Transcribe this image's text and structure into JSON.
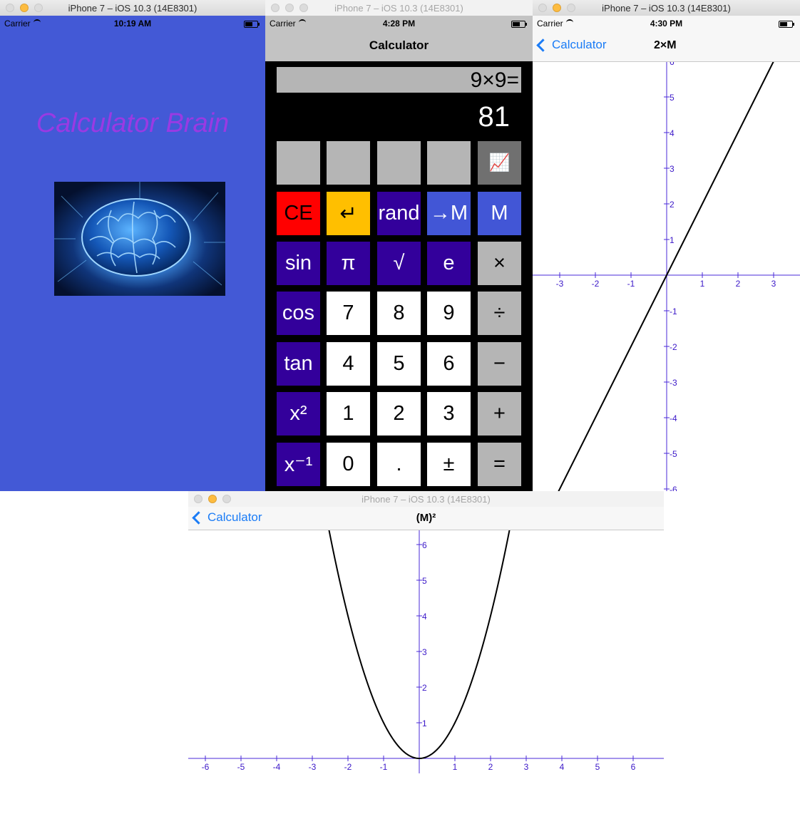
{
  "windows": {
    "brand": {
      "title": "iPhone 7 – iOS 10.3 (14E8301)",
      "carrier": "Carrier",
      "time": "10:19 AM",
      "app_title": "Calculator Brain"
    },
    "calculator": {
      "title": "iPhone 7 – iOS 10.3 (14E8301)",
      "carrier": "Carrier",
      "time": "4:28 PM",
      "nav_title": "Calculator",
      "description": "9×9=",
      "display": "81",
      "keys": [
        [
          "",
          "",
          "",
          "",
          "📈"
        ],
        [
          "CE",
          "↵",
          "rand",
          "→M",
          "M"
        ],
        [
          "sin",
          "π",
          "√",
          "e",
          "×"
        ],
        [
          "cos",
          "7",
          "8",
          "9",
          "÷"
        ],
        [
          "tan",
          "4",
          "5",
          "6",
          "−"
        ],
        [
          "x²",
          "1",
          "2",
          "3",
          "+"
        ],
        [
          "x⁻¹",
          "0",
          ".",
          "±",
          "="
        ]
      ],
      "key_styles": [
        [
          "gray",
          "gray",
          "gray",
          "gray",
          "dgray"
        ],
        [
          "red",
          "yel",
          "purple",
          "blue",
          "blue"
        ],
        [
          "purple",
          "purple",
          "purple",
          "purple",
          "gray"
        ],
        [
          "purple",
          "white",
          "white",
          "white",
          "gray"
        ],
        [
          "purple",
          "white",
          "white",
          "white",
          "gray"
        ],
        [
          "purple",
          "white",
          "white",
          "white",
          "gray"
        ],
        [
          "purple",
          "white",
          "white",
          "white",
          "gray"
        ]
      ]
    },
    "graph_linear": {
      "title": "iPhone 7 – iOS 10.3 (14E8301)",
      "carrier": "Carrier",
      "time": "4:30 PM",
      "back_label": "Calculator",
      "nav_title": "2×M"
    },
    "graph_square": {
      "title": "iPhone 7 – iOS 10.3 (14E8301)",
      "back_label": "Calculator",
      "nav_title": "(M)²"
    }
  },
  "colors": {
    "axis": "#4a2ad8",
    "tick_label": "#3a17c8",
    "curve": "#000000",
    "ios_blue": "#1b7cf6",
    "brand_bg": "#4359d6",
    "brand_text": "#9a3ae3"
  },
  "chart_data": [
    {
      "type": "line",
      "function": "2x",
      "x_ticks": [
        -3,
        -2,
        -1,
        1,
        2,
        3
      ],
      "y_ticks": [
        -6,
        -5,
        -4,
        -3,
        -2,
        -1,
        1,
        2,
        3,
        4,
        5,
        6
      ],
      "grid": false
    },
    {
      "type": "line",
      "function": "x^2",
      "x_ticks": [
        -6,
        -5,
        -4,
        -3,
        -2,
        -1,
        1,
        2,
        3,
        4,
        5,
        6
      ],
      "y_ticks": [
        1,
        2,
        3,
        4,
        5,
        6
      ],
      "grid": false
    }
  ]
}
